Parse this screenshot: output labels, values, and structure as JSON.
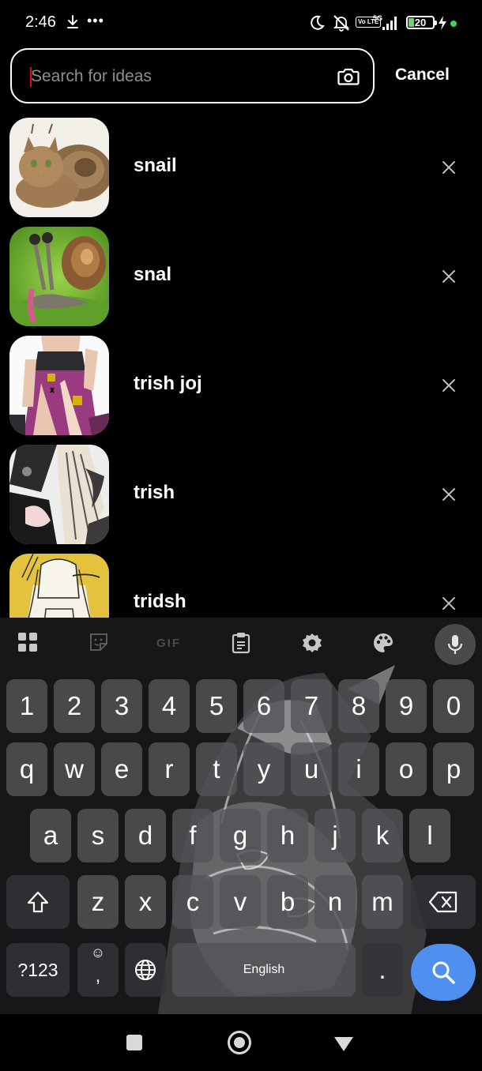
{
  "status_bar": {
    "time": "2:46",
    "battery": "20",
    "network": "5G",
    "volte": "Vo LTE",
    "more_indicator": "•••"
  },
  "search": {
    "placeholder": "Search for ideas",
    "value": "",
    "cancel_label": "Cancel"
  },
  "recent_searches": [
    {
      "label": "snail",
      "thumbnail": "cat-snail-image"
    },
    {
      "label": "snal",
      "thumbnail": "snail-on-leaf-image"
    },
    {
      "label": "trish joj",
      "thumbnail": "anime-character-image"
    },
    {
      "label": "trish",
      "thumbnail": "manga-character-image"
    },
    {
      "label": "tridsh",
      "thumbnail": "manga-sketch-image"
    }
  ],
  "keyboard": {
    "toolbar": {
      "gif_label": "GIF",
      "icons": [
        "apps-grid-icon",
        "sticker-icon",
        "gif-icon",
        "clipboard-icon",
        "gear-icon",
        "palette-icon",
        "microphone-icon"
      ]
    },
    "number_row": [
      "1",
      "2",
      "3",
      "4",
      "5",
      "6",
      "7",
      "8",
      "9",
      "0"
    ],
    "row1": [
      "q",
      "w",
      "e",
      "r",
      "t",
      "y",
      "u",
      "i",
      "o",
      "p"
    ],
    "row2": [
      "a",
      "s",
      "d",
      "f",
      "g",
      "h",
      "j",
      "k",
      "l"
    ],
    "row3": [
      "z",
      "x",
      "c",
      "v",
      "b",
      "n",
      "m"
    ],
    "symbols_label": "?123",
    "comma_label": ",",
    "space_label": "English",
    "period_label": "."
  },
  "colors": {
    "accent_search": "#4f8ff0",
    "caret": "#e60023",
    "battery": "#6bd46b"
  }
}
